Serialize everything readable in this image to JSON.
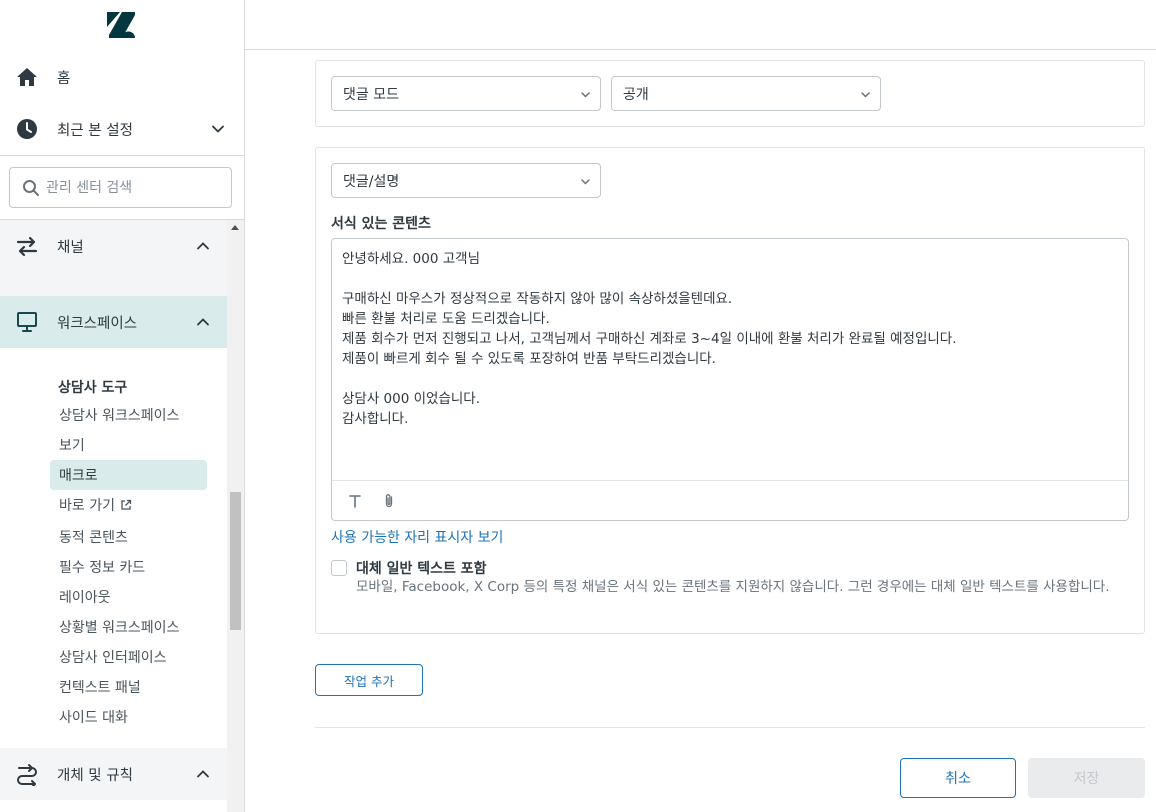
{
  "sidebar": {
    "home_label": "홈",
    "recent_label": "최근 본 설정",
    "search_placeholder": "관리 센터 검색",
    "groups": {
      "channels": "채널",
      "workspaces": "워크스페이스",
      "objects_rules": "개체 및 규칙"
    },
    "agent_tools_heading": "상담사 도구",
    "items": [
      "상담사 워크스페이스",
      "보기",
      "매크로",
      "바로 가기",
      "동적 콘텐츠",
      "필수 정보 카드",
      "레이아웃",
      "상황별 워크스페이스",
      "상담사 인터페이스",
      "컨텍스트 패널",
      "사이드 대화"
    ],
    "selected_item": "매크로"
  },
  "action1": {
    "field": "댓글 모드",
    "value": "공개"
  },
  "action2": {
    "field": "댓글/설명",
    "content_label": "서식 있는 콘텐츠",
    "body_lines": [
      "안녕하세요. 000 고객님",
      "",
      "구매하신 마우스가 정상적으로 작동하지 않아 많이 속상하셨을텐데요.",
      "빠른 환불 처리로 도움 드리겠습니다.",
      "제품 회수가 먼저 진행되고 나서, 고객님께서 구매하신 계좌로 3~4일 이내에 환불 처리가 완료될 예정입니다.",
      "제품이 빠르게 회수 될 수 있도록 포장하여 반품 부탁드리겠습니다.",
      "",
      "상담사 000 이었습니다.",
      "감사합니다."
    ],
    "placeholder_link": "사용 가능한 자리 표시자 보기",
    "fallback_label": "대체 일반 텍스트 포함",
    "fallback_checked": false,
    "fallback_hint": "모바일, Facebook, X Corp 등의 특정 채널은 서식 있는 콘텐츠를 지원하지 않습니다. 그런 경우에는 대체 일반 텍스트를 사용합니다."
  },
  "buttons": {
    "add_action": "작업 추가",
    "cancel": "취소",
    "save": "저장"
  },
  "colors": {
    "accent": "#1f73b7",
    "active_nav_bg": "#d9ebea",
    "disabled_bg": "#e9ebed"
  }
}
